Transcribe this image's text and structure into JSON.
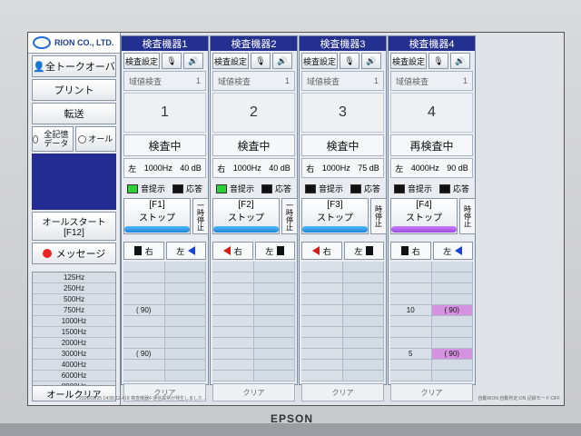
{
  "app": {
    "logo_text": "RION CO., LTD.",
    "left_buttons": {
      "all_talk_over": "全トークオーバ",
      "print": "プリント",
      "transfer": "転送",
      "all_memory": "全記憶\nデータ",
      "all": "オール",
      "all_start": "オールスタート\n[F12]",
      "message": "メッセージ",
      "all_clear": "オールクリア"
    },
    "frequencies": [
      "125Hz",
      "250Hz",
      "500Hz",
      "750Hz",
      "1000Hz",
      "1500Hz",
      "2000Hz",
      "3000Hz",
      "4000Hz",
      "6000Hz",
      "8000Hz"
    ]
  },
  "panels": [
    {
      "title": "検査機器1",
      "setup": "検査設定",
      "inspection_label": "域値検査",
      "inspection_value": "1",
      "number": "1",
      "state": "検査中",
      "ear": "左",
      "freq": "1000Hz",
      "db": "40 dB",
      "tone": "音提示",
      "response": "応答",
      "stop_key": "[F1]",
      "stop_label": "ストップ",
      "pause": "一時停止",
      "bar_color": "blue",
      "right_ear": "右",
      "left_ear": "左",
      "results": [
        [
          "",
          ""
        ],
        [
          "",
          ""
        ],
        [
          "",
          ""
        ],
        [
          "",
          ""
        ],
        [
          "( 90)",
          ""
        ],
        [
          "",
          ""
        ],
        [
          "",
          ""
        ],
        [
          "",
          ""
        ],
        [
          "( 90)",
          ""
        ],
        [
          "",
          ""
        ],
        [
          "",
          ""
        ]
      ],
      "clear": "クリア"
    },
    {
      "title": "検査機器2",
      "setup": "検査設定",
      "inspection_label": "域値検査",
      "inspection_value": "1",
      "number": "2",
      "state": "検査中",
      "ear": "右",
      "freq": "1000Hz",
      "db": "40 dB",
      "tone": "音提示",
      "response": "応答",
      "stop_key": "[F2]",
      "stop_label": "ストップ",
      "pause": "一時停止",
      "bar_color": "blue",
      "right_ear": "右",
      "left_ear": "左",
      "results": [
        [
          "",
          ""
        ],
        [
          "",
          ""
        ],
        [
          "",
          ""
        ],
        [
          "",
          ""
        ],
        [
          "",
          ""
        ],
        [
          "",
          ""
        ],
        [
          "",
          ""
        ],
        [
          "",
          ""
        ],
        [
          "",
          ""
        ],
        [
          "",
          ""
        ],
        [
          "",
          ""
        ]
      ],
      "clear": "クリア"
    },
    {
      "title": "検査機器3",
      "setup": "検査設定",
      "inspection_label": "域値検査",
      "inspection_value": "1",
      "number": "3",
      "state": "検査中",
      "ear": "右",
      "freq": "1000Hz",
      "db": "75 dB",
      "tone": "音提示",
      "response": "応答",
      "stop_key": "[F3]",
      "stop_label": "ストップ",
      "pause": "時停止",
      "bar_color": "blue",
      "right_ear": "右",
      "left_ear": "左",
      "results": [
        [
          "",
          ""
        ],
        [
          "",
          ""
        ],
        [
          "",
          ""
        ],
        [
          "",
          ""
        ],
        [
          "",
          ""
        ],
        [
          "",
          ""
        ],
        [
          "",
          ""
        ],
        [
          "",
          ""
        ],
        [
          "",
          ""
        ],
        [
          "",
          ""
        ],
        [
          "",
          ""
        ]
      ],
      "clear": "クリア"
    },
    {
      "title": "検査機器4",
      "setup": "検査設定",
      "inspection_label": "域値検査",
      "inspection_value": "1",
      "number": "4",
      "state": "再検査中",
      "ear": "左",
      "freq": "4000Hz",
      "db": "90 dB",
      "tone": "音提示",
      "response": "応答",
      "stop_key": "[F4]",
      "stop_label": "ストップ",
      "pause": "時停止",
      "bar_color": "purple",
      "right_ear": "右",
      "left_ear": "左",
      "results": [
        [
          "",
          ""
        ],
        [
          "",
          ""
        ],
        [
          "",
          ""
        ],
        [
          "",
          ""
        ],
        [
          "10",
          "( 90)"
        ],
        [
          "",
          ""
        ],
        [
          "",
          ""
        ],
        [
          "",
          ""
        ],
        [
          "5",
          "( 90)"
        ],
        [
          "",
          ""
        ],
        [
          "",
          ""
        ]
      ],
      "clear": "クリア"
    }
  ],
  "status_left": "2021/01/25 14:05:12.418 検査機器4 通信異常が発生しました ...",
  "status_right": "自動RION 自動判定:ON 記録モード:OFF",
  "monitor_brand": "EPSON"
}
